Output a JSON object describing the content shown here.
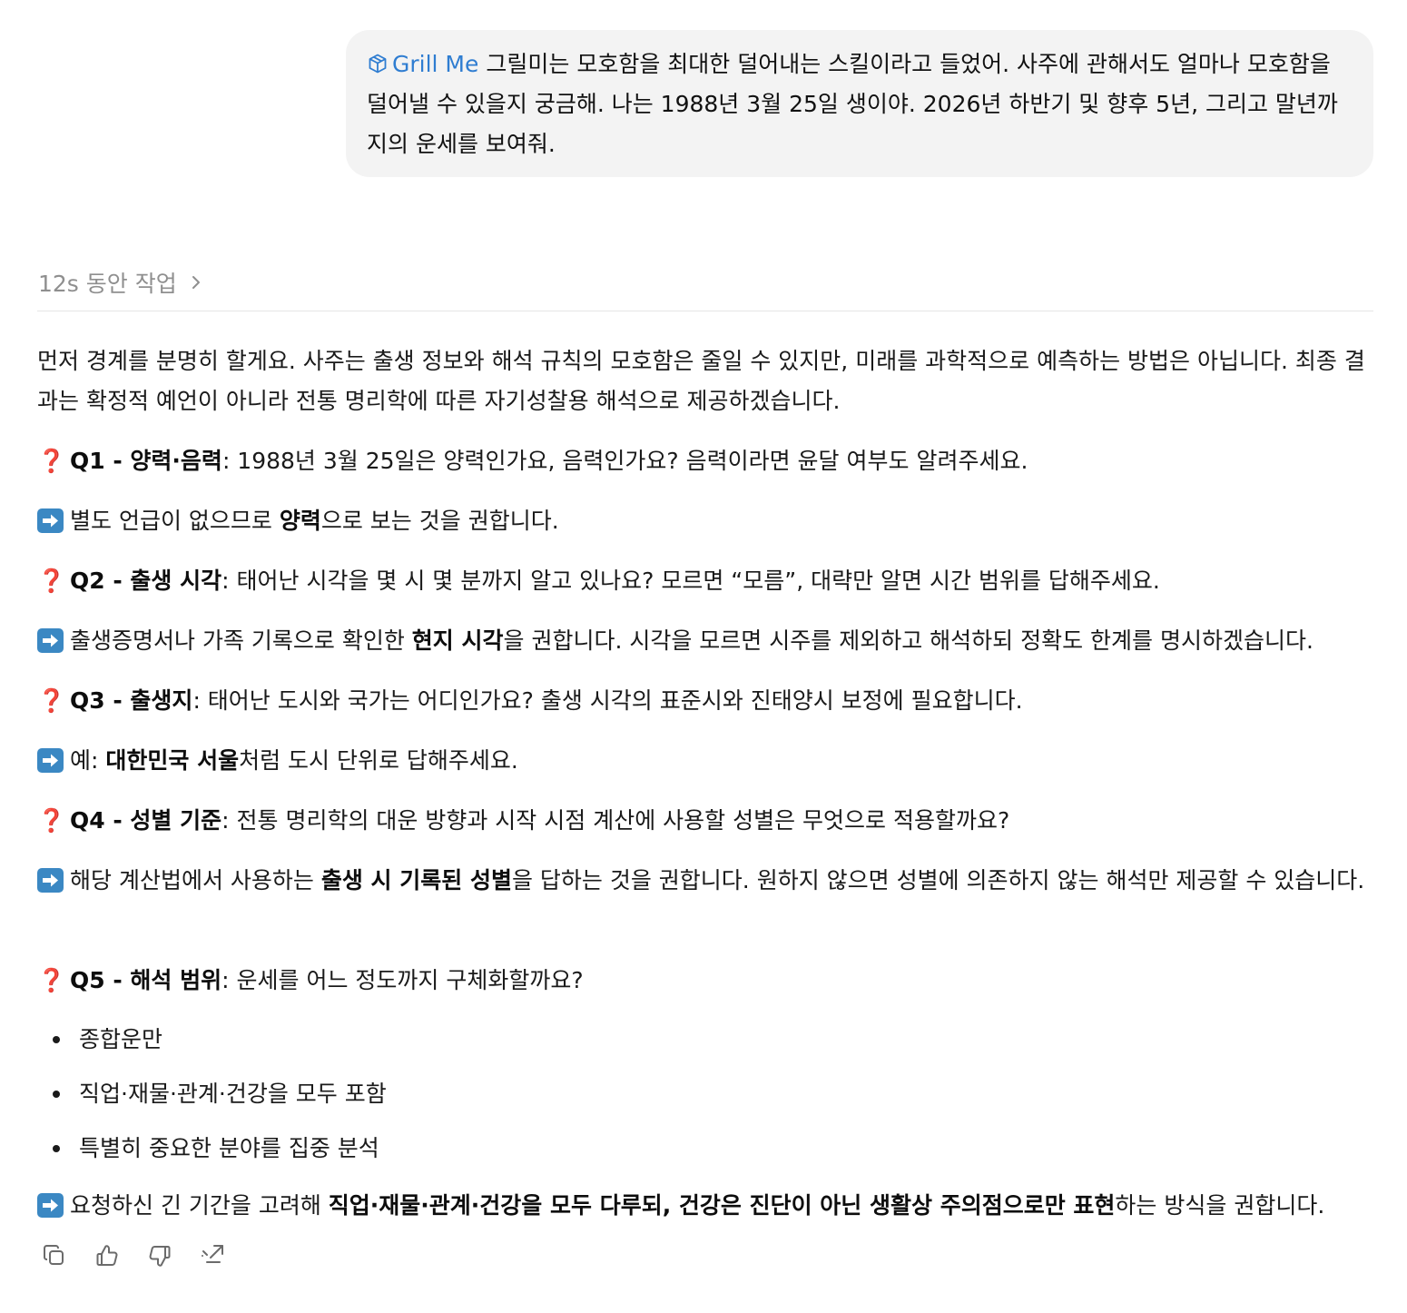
{
  "user_message": {
    "skill_chip": "Grill Me",
    "text": "그릴미는 모호함을 최대한 덜어내는 스킬이라고 들었어. 사주에 관해서도 얼마나 모호함을 덜어낼 수 있을지 궁금해. 나는 1988년 3월 25일 생이야. 2026년 하반기 및 향후 5년, 그리고 말년까지의 운세를 보여줘."
  },
  "thinking": {
    "label": "12s 동안 작업"
  },
  "assistant": {
    "intro": "먼저 경계를 분명히 할게요. 사주는 출생 정보와 해석 규칙의 모호함은 줄일 수 있지만, 미래를 과학적으로 예측하는 방법은 아닙니다. 최종 결과는 확정적 예언이 아니라 전통 명리학에 따른 자기성찰용 해석으로 제공하겠습니다.",
    "q1": {
      "mark": "❓",
      "title": "Q1 - 양력·음력",
      "text": ": 1988년 3월 25일은 양력인가요, 음력인가요? 음력이라면 윤달 여부도 알려주세요."
    },
    "a1": {
      "pre": "별도 언급이 없으므로 ",
      "bold": "양력",
      "post": "으로 보는 것을 권합니다."
    },
    "q2": {
      "mark": "❓",
      "title": "Q2 - 출생 시각",
      "text": ": 태어난 시각을 몇 시 몇 분까지 알고 있나요? 모르면 “모름”, 대략만 알면 시간 범위를 답해주세요."
    },
    "a2": {
      "pre": "출생증명서나 가족 기록으로 확인한 ",
      "bold": "현지 시각",
      "post": "을 권합니다. 시각을 모르면 시주를 제외하고 해석하되 정확도 한계를 명시하겠습니다."
    },
    "q3": {
      "mark": "❓",
      "title": "Q3 - 출생지",
      "text": ": 태어난 도시와 국가는 어디인가요? 출생 시각의 표준시와 진태양시 보정에 필요합니다."
    },
    "a3": {
      "pre": "예: ",
      "bold": "대한민국 서울",
      "post": "처럼 도시 단위로 답해주세요."
    },
    "q4": {
      "mark": "❓",
      "title": "Q4 - 성별 기준",
      "text": ": 전통 명리학의 대운 방향과 시작 시점 계산에 사용할 성별은 무엇으로 적용할까요?"
    },
    "a4": {
      "pre": "해당 계산법에서 사용하는 ",
      "bold": "출생 시 기록된 성별",
      "post": "을 답하는 것을 권합니다. 원하지 않으면 성별에 의존하지 않는 해석만 제공할 수 있습니다."
    },
    "q5": {
      "mark": "❓",
      "title": "Q5 - 해석 범위",
      "text": ": 운세를 어느 정도까지 구체화할까요?"
    },
    "options": [
      "종합운만",
      "직업·재물·관계·건강을 모두 포함",
      "특별히 중요한 분야를 집중 분석"
    ],
    "a5": {
      "pre": "요청하신 긴 기간을 고려해 ",
      "bold": "직업·재물·관계·건강을 모두 다루되, 건강은 진단이 아닌 생활상 주의점으로만 표현",
      "post": "하는 방식을 권합니다."
    }
  },
  "actions": [
    "copy-icon",
    "thumbs-up-icon",
    "thumbs-down-icon",
    "share-icon"
  ],
  "colors": {
    "skill_chip": "#2f7dd1",
    "question_mark": "#e0262e",
    "arrow_box": "#3b88c3",
    "bubble_bg": "#f3f3f3"
  }
}
